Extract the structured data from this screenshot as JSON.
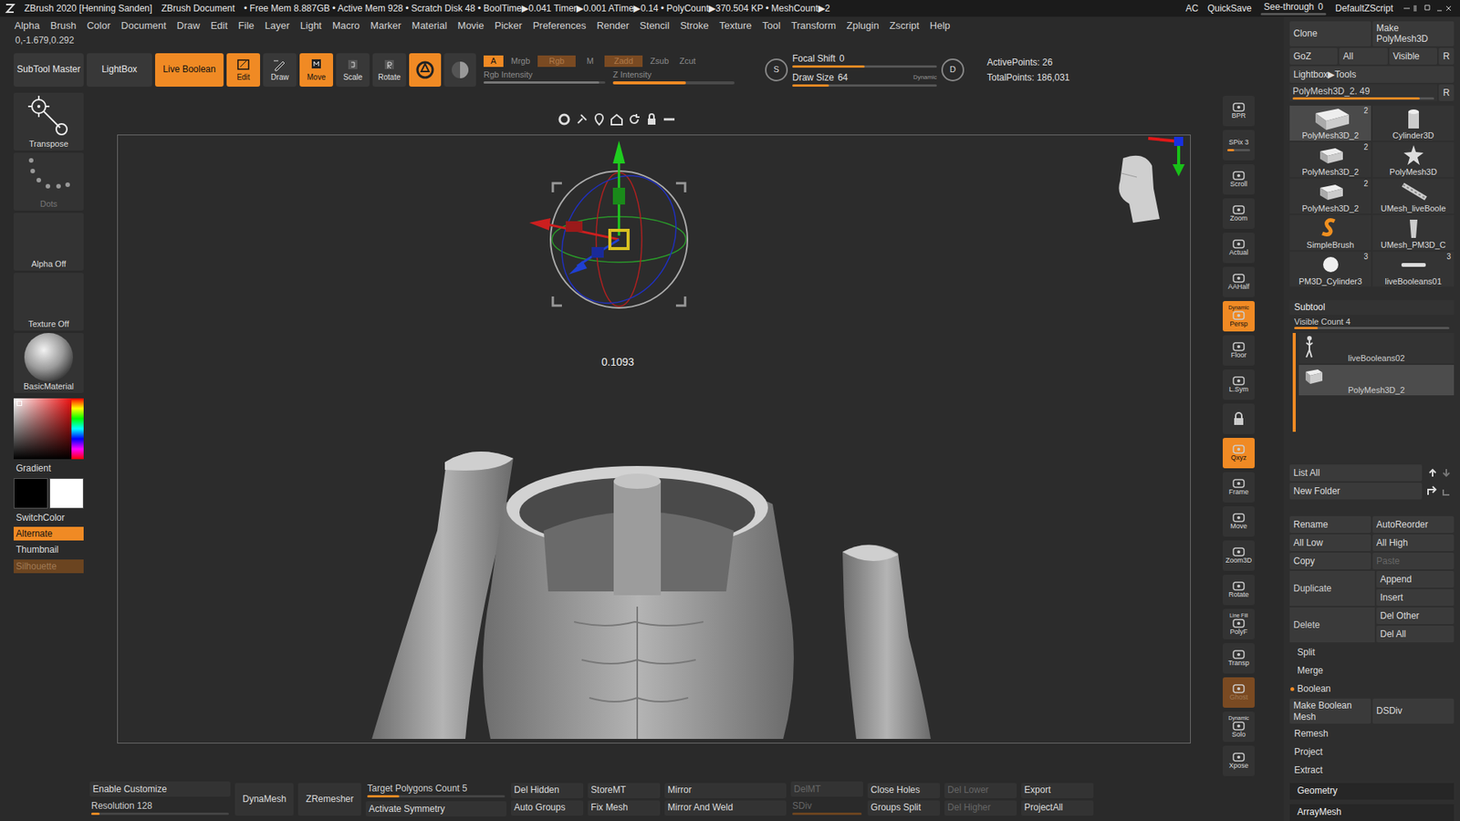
{
  "title_bar": {
    "app": "ZBrush 2020 [Henning Sanden]",
    "document": "ZBrush Document",
    "stats": "• Free Mem 8.887GB • Active Mem 928 • Scratch Disk 48 • BoolTime▶0.041 Timer▶0.001 ATime▶0.14 • PolyCount▶370.504 KP • MeshCount▶2",
    "ac": "AC",
    "quicksave": "QuickSave",
    "see_through": {
      "label": "See-through",
      "value": "0",
      "level": 0
    },
    "script": "DefaultZScript"
  },
  "menu": [
    "Alpha",
    "Brush",
    "Color",
    "Document",
    "Draw",
    "Edit",
    "File",
    "Layer",
    "Light",
    "Macro",
    "Marker",
    "Material",
    "Movie",
    "Picker",
    "Preferences",
    "Render",
    "Stencil",
    "Stroke",
    "Texture",
    "Tool",
    "Transform",
    "Zplugin",
    "Zscript",
    "Help"
  ],
  "coordinates": "0,-1.679,0.292",
  "shelf": {
    "subtool_master": {
      "label": "SubTool Master",
      "on": false
    },
    "lightbox": {
      "label": "LightBox",
      "on": false
    },
    "live_boolean": {
      "label": "Live Boolean",
      "on": true
    },
    "modes": [
      {
        "label": "Edit",
        "on": true
      },
      {
        "label": "Draw",
        "on": false
      },
      {
        "label": "Move",
        "on": true
      },
      {
        "label": "Scale",
        "on": false
      },
      {
        "label": "Rotate",
        "on": false
      }
    ],
    "modifiers": [
      {
        "on": true
      },
      {
        "on": false
      }
    ],
    "channels": [
      {
        "label": "A",
        "state": "on"
      },
      {
        "label": "Mrgb",
        "state": "off"
      },
      {
        "label": "Rgb",
        "state": "dim"
      },
      {
        "label": "M",
        "state": "off"
      },
      {
        "label": "Zadd",
        "state": "dim"
      },
      {
        "label": "Zsub",
        "state": "off"
      },
      {
        "label": "Zcut",
        "state": "off"
      }
    ],
    "intensity": [
      {
        "label": "Rgb Intensity",
        "level": 0.95,
        "on": false
      },
      {
        "label": "Z Intensity",
        "level": 0.6,
        "on": true
      }
    ],
    "sliders": [
      {
        "key": "S",
        "label": "Focal Shift",
        "value": "0",
        "level": 0.5
      },
      {
        "key": "D",
        "label": "Draw Size",
        "value": "64",
        "level": 0.25
      }
    ],
    "dynamic": "Dynamic",
    "points": [
      {
        "label": "ActivePoints:",
        "value": "26"
      },
      {
        "label": "TotalPoints:",
        "value": "186,031"
      }
    ]
  },
  "left_tools": {
    "items": [
      {
        "label": "Transpose",
        "disabled": false
      },
      {
        "label": "Dots",
        "disabled": true
      },
      {
        "label": "Alpha Off",
        "disabled": false
      },
      {
        "label": "Texture Off",
        "disabled": false
      },
      {
        "label": "BasicMaterial",
        "disabled": false
      }
    ],
    "gradient": "Gradient",
    "switch_color": "SwitchColor",
    "toggles": [
      {
        "label": "Alternate",
        "state": "on"
      },
      {
        "label": "Thumbnail",
        "state": "off"
      },
      {
        "label": "Silhouette",
        "state": "dim"
      }
    ]
  },
  "viewport": {
    "readout": "0.1093"
  },
  "right_shelf": [
    {
      "kind": "button",
      "label": "BPR",
      "caption": "",
      "state": "off"
    },
    {
      "kind": "slider",
      "label": "SPix 3",
      "caption": "",
      "state": "off",
      "level": 0.3
    },
    {
      "kind": "button",
      "label": "Scroll",
      "caption": "",
      "state": "off"
    },
    {
      "kind": "button",
      "label": "Zoom",
      "caption": "",
      "state": "off"
    },
    {
      "kind": "button",
      "label": "Actual",
      "caption": "",
      "state": "off"
    },
    {
      "kind": "button",
      "label": "AAHalf",
      "caption": "",
      "state": "off"
    },
    {
      "kind": "button",
      "label": "Persp",
      "caption": "Dynamic",
      "state": "on"
    },
    {
      "kind": "button",
      "label": "Floor",
      "caption": "",
      "state": "off"
    },
    {
      "kind": "button",
      "label": "L.Sym",
      "caption": "",
      "state": "off"
    },
    {
      "kind": "icon",
      "label": "",
      "caption": "",
      "state": "off"
    },
    {
      "kind": "button",
      "label": "Qxyz",
      "caption": "",
      "state": "on"
    },
    {
      "kind": "button",
      "label": "Frame",
      "caption": "",
      "state": "off"
    },
    {
      "kind": "button",
      "label": "Move",
      "caption": "",
      "state": "off"
    },
    {
      "kind": "button",
      "label": "Zoom3D",
      "caption": "",
      "state": "off"
    },
    {
      "kind": "button",
      "label": "Rotate",
      "caption": "",
      "state": "off"
    },
    {
      "kind": "button",
      "label": "PolyF",
      "caption": "Line Fill",
      "state": "off"
    },
    {
      "kind": "button",
      "label": "Transp",
      "caption": "",
      "state": "off"
    },
    {
      "kind": "button",
      "label": "Ghost",
      "caption": "",
      "state": "dim"
    },
    {
      "kind": "button",
      "label": "Solo",
      "caption": "Dynamic",
      "state": "off"
    },
    {
      "kind": "button",
      "label": "Xpose",
      "caption": "",
      "state": "off"
    }
  ],
  "bottom_bar": [
    [
      {
        "label": "Enable Customize",
        "kind": "button",
        "disabled": false
      },
      {
        "label": "Resolution 128",
        "kind": "slider",
        "level": 0.06,
        "disabled": false
      }
    ],
    [
      {
        "label": "DynaMesh",
        "kind": "button",
        "disabled": false
      }
    ],
    [
      {
        "label": "ZRemesher",
        "kind": "button",
        "disabled": false
      }
    ],
    [
      {
        "label": "Target Polygons Count 5",
        "kind": "slider",
        "level": 0.23,
        "disabled": false
      },
      {
        "label": "Activate Symmetry",
        "kind": "button",
        "disabled": false
      }
    ],
    [
      {
        "label": "Del Hidden",
        "kind": "button",
        "disabled": false
      },
      {
        "label": "Auto Groups",
        "kind": "button",
        "disabled": false
      }
    ],
    [
      {
        "label": "StoreMT",
        "kind": "button",
        "disabled": false
      },
      {
        "label": "Fix Mesh",
        "kind": "button",
        "disabled": false
      }
    ],
    [
      {
        "label": "Mirror",
        "kind": "button",
        "disabled": false
      },
      {
        "label": "Mirror And Weld",
        "kind": "button",
        "disabled": false
      }
    ],
    [
      {
        "label": "DelMT",
        "kind": "button",
        "disabled": true
      },
      {
        "label": "SDiv",
        "kind": "slider",
        "level": 1,
        "disabled": true
      }
    ],
    [
      {
        "label": "Close Holes",
        "kind": "button",
        "disabled": false
      },
      {
        "label": "Groups Split",
        "kind": "button",
        "disabled": false
      }
    ],
    [
      {
        "label": "Del Lower",
        "kind": "button",
        "disabled": true
      },
      {
        "label": "Del Higher",
        "kind": "button",
        "disabled": true
      }
    ],
    [
      {
        "label": "Export",
        "kind": "button",
        "disabled": false
      },
      {
        "label": "ProjectAll",
        "kind": "button",
        "disabled": false
      }
    ]
  ],
  "tool_panel": {
    "row1": [
      {
        "label": "Clone"
      },
      {
        "label": "Make PolyMesh3D"
      }
    ],
    "row2": [
      {
        "label": "GoZ"
      },
      {
        "label": "All"
      },
      {
        "label": "Visible"
      },
      {
        "label": "R"
      }
    ],
    "lightbox": "Lightbox▶Tools",
    "current": {
      "label": "PolyMesh3D_2. 49",
      "level": 0.9,
      "r": "R"
    },
    "tools": [
      {
        "label": "PolyMesh3D_2",
        "count": "2",
        "selected": true
      },
      {
        "label": "Cylinder3D",
        "count": "",
        "selected": false
      },
      {
        "label": "PolyMesh3D_2",
        "count": "2",
        "selected": false
      },
      {
        "label": "PolyMesh3D",
        "count": "",
        "selected": false
      },
      {
        "label": "PolyMesh3D_2",
        "count": "2",
        "selected": false
      },
      {
        "label": "UMesh_liveBoole",
        "count": "",
        "selected": false
      },
      {
        "label": "SimpleBrush",
        "count": "",
        "selected": false
      },
      {
        "label": "UMesh_PM3D_C",
        "count": "",
        "selected": false
      },
      {
        "label": "PM3D_Cylinder3",
        "count": "3",
        "selected": false
      },
      {
        "label": "liveBooleans01",
        "count": "3",
        "selected": false
      }
    ],
    "subtool": {
      "title": "Subtool",
      "visible_count": "Visible Count 4",
      "level": 0.15,
      "items": [
        {
          "label": "liveBooleans02",
          "selected": false
        },
        {
          "label": "PolyMesh3D_2",
          "selected": true
        }
      ]
    },
    "list_all": "List All",
    "new_folder": "New Folder",
    "rows": [
      [
        {
          "label": "Rename",
          "disabled": false
        },
        {
          "label": "AutoReorder",
          "disabled": false
        }
      ],
      [
        {
          "label": "All Low",
          "disabled": false
        },
        {
          "label": "All High",
          "disabled": false
        }
      ],
      [
        {
          "label": "Copy",
          "disabled": false
        },
        {
          "label": "Paste",
          "disabled": true
        }
      ]
    ],
    "tall": [
      {
        "label": "Duplicate",
        "subs": [
          "Append",
          "Insert"
        ]
      },
      {
        "label": "Delete",
        "subs": [
          "Del Other",
          "Del All"
        ]
      }
    ],
    "sections": [
      {
        "label": "Split",
        "on": false
      },
      {
        "label": "Merge",
        "on": false
      },
      {
        "label": "Boolean",
        "on": true
      }
    ],
    "boolean_row": [
      {
        "label": "Make Boolean Mesh"
      },
      {
        "label": "DSDiv"
      }
    ],
    "sections2": [
      {
        "label": "Remesh"
      },
      {
        "label": "Project"
      },
      {
        "label": "Extract"
      }
    ],
    "headers": [
      "Geometry",
      "ArrayMesh"
    ]
  }
}
